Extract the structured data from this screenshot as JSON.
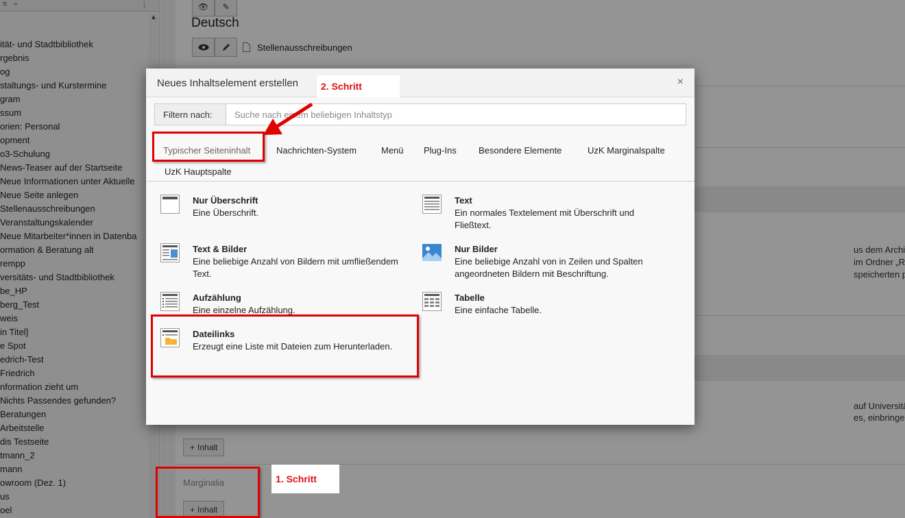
{
  "sidebar": {
    "tree": [
      "ität- und Stadtbibliothek",
      "rgebnis",
      "og",
      "staltungs- und Kurstermine",
      "gram",
      "ssum",
      "orien: Personal",
      "opment",
      "o3-Schulung",
      "News-Teaser auf der Startseite",
      "Neue Informationen unter Aktuelle",
      "Neue Seite anlegen",
      "Stellenausschreibungen",
      "Veranstaltungskalender",
      "Neue Mitarbeiter*innen in Datenba",
      "ormation & Beratung alt",
      "rempp",
      "versitäts- und Stadtbibliothek",
      "be_HP",
      "berg_Test",
      "weis",
      "in Titel]",
      "e Spot",
      "edrich-Test",
      "Friedrich",
      "nformation zieht um",
      "Nichts Passendes gefunden?",
      "Beratungen",
      "Arbeitstelle",
      "dis Testseite",
      "tmann_2",
      "mann",
      "owroom (Dez. 1)",
      "us",
      "oel"
    ]
  },
  "main": {
    "language": "Deutsch",
    "page_name": "Stellenausschreibungen",
    "bg_texts": [
      "us dem Archiv holen, wieder aktiv stellen bei neu",
      "im Ordner „Ressourcen -> Stellenausschreibunge",
      "speicherten pdf verknüpfen  (bei SHK-Stellen gibt"
    ],
    "bg_texts2": [
      "auf Universitäts- und Stadtbibliothek gehen, zu W",
      "es, einbringen Teaser-URL verknüpfen Teaser an e"
    ],
    "inhalt_label": "Inhalt",
    "marginalia_label": "Marginalia"
  },
  "modal": {
    "title": "Neues Inhaltselement erstellen",
    "close": "×",
    "filter_label": "Filtern nach:",
    "filter_placeholder": "Suche nach einem beliebigen Inhaltstyp",
    "tabs": [
      "Typischer Seiteninhalt",
      "Nachrichten-System",
      "Menü",
      "Plug-Ins",
      "Besondere Elemente",
      "UzK Marginalspalte",
      "UzK Hauptspalte"
    ],
    "elements": [
      {
        "title": "Nur Überschrift",
        "desc": "Eine Überschrift.",
        "icon": "header-only-icon"
      },
      {
        "title": "Text",
        "desc": "Ein normales Textelement mit Überschrift und Fließtext.",
        "icon": "text-icon"
      },
      {
        "title": "Text & Bilder",
        "desc": "Eine beliebige Anzahl von Bildern mit umfließendem Text.",
        "icon": "text-image-icon"
      },
      {
        "title": "Nur Bilder",
        "desc": "Eine beliebige Anzahl von in Zeilen und Spalten angeordneten Bildern mit Beschriftung.",
        "icon": "images-only-icon"
      },
      {
        "title": "Aufzählung",
        "desc": "Eine einzelne Aufzählung.",
        "icon": "bullet-list-icon"
      },
      {
        "title": "Tabelle",
        "desc": "Eine einfache Tabelle.",
        "icon": "table-icon"
      },
      {
        "title": "Dateilinks",
        "desc": "Erzeugt eine Liste mit Dateien zum Herunterladen.",
        "icon": "file-links-icon"
      }
    ]
  },
  "annotations": {
    "step1": "1. Schritt",
    "step2": "2. Schritt",
    "color": "#e00000"
  }
}
